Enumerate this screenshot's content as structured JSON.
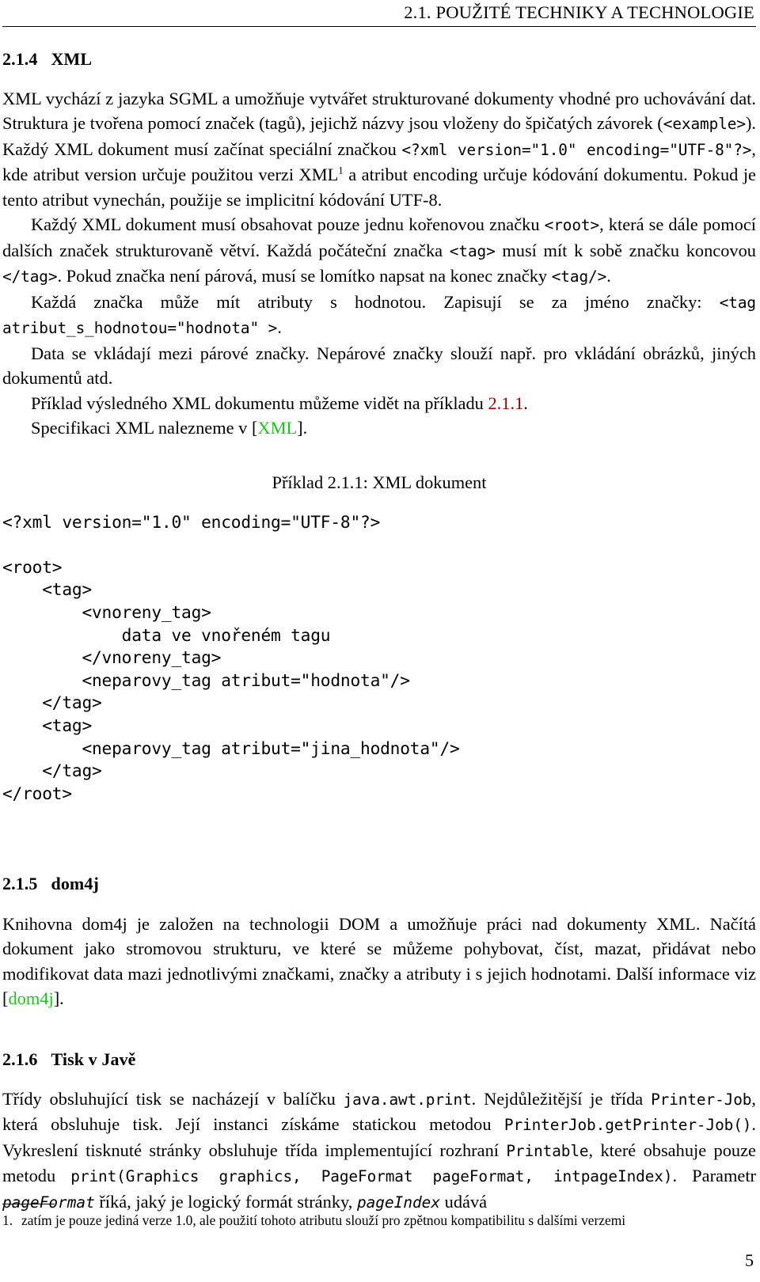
{
  "header": {
    "running_head": "2.1.  POUŽITÉ TECHNIKY A TECHNOLOGIE"
  },
  "sections": {
    "xml": {
      "number": "2.1.4",
      "title": "XML",
      "paragraphs": {
        "p1": {
          "t1": "XML vychází z jazyka SGML a umožňuje vytvářet strukturované dokumenty vhodné pro uchovávání dat. Struktura je tvořena pomocí značek (tagů), jejichž názvy jsou vloženy do špičatých závorek (",
          "c1": "<example>",
          "t2": "). Každý XML dokument musí začínat speciální značkou ",
          "c2": "<?xml version=\"1.0\" encoding=\"UTF-8\"?>",
          "t3": ", kde atribut version určuje použitou verzi XML",
          "fnmark": "1",
          "t4": " a atribut encoding určuje kódování dokumentu. Pokud je tento atribut vynechán, použije se implicitní kódování UTF-8."
        },
        "p2": {
          "t1": "Každý XML dokument musí obsahovat pouze jednu kořenovou značku ",
          "c1": "<root>",
          "t2": ", která se dále pomocí dalších značek strukturovaně větví. Každá počáteční značka ",
          "c2": "<tag>",
          "t3": " musí mít k sobě značku koncovou ",
          "c3": "</tag>",
          "t4": ". Pokud značka není párová, musí se lomítko napsat na konec značky ",
          "c4": "<tag/>",
          "t5": "."
        },
        "p3": {
          "t1": "Každá značka může mít atributy s hodnotou. Zapisují se za jméno značky: ",
          "c1": "<tag atribut_",
          "c2": "s_hodnotou=\"hodnota\" >",
          "t2": "."
        },
        "p4": {
          "t1": "Data se vkládají mezi párové značky. Nepárové značky slouží např. pro vkládání obrázků, jiných dokumentů atd."
        },
        "p5": {
          "t1": "Příklad výsledného XML dokumentu můžeme vidět na příkladu ",
          "ref": "2.1.1",
          "t2": "."
        },
        "p6": {
          "t1": "Specifikaci XML nalezneme v [",
          "cite": "XML",
          "t2": "]."
        }
      },
      "example": {
        "caption": "Příklad 2.1.1: XML dokument",
        "code": "<?xml version=\"1.0\" encoding=\"UTF-8\"?>\n\n<root>\n    <tag>\n        <vnoreny_tag>\n            data ve vnořeném tagu\n        </vnoreny_tag>\n        <neparovy_tag atribut=\"hodnota\"/>\n    </tag>\n    <tag>\n        <neparovy_tag atribut=\"jina_hodnota\"/>\n    </tag>\n</root>"
      }
    },
    "dom4j": {
      "number": "2.1.5",
      "title": "dom4j",
      "paragraph": {
        "t1": "Knihovna dom4j je založen na technologii DOM a umožňuje práci nad dokumenty XML. Načítá dokument jako stromovou strukturu, ve které se můžeme pohybovat, číst, mazat, přidávat nebo modifikovat data mazi jednotlivými značkami, značky a atributy i s jejich hodnotami. Další informace viz [",
        "cite": "dom4j",
        "t2": "]."
      }
    },
    "tisk": {
      "number": "2.1.6",
      "title": "Tisk v Javě",
      "paragraph": {
        "t1": "Třídy obsluhující tisk se nacházejí v balíčku ",
        "c1": "java.awt.print",
        "t2": ". Nejdůležitější je třída ",
        "c2": "Printer-",
        "c3": "Job",
        "t3": ", která obsluhuje tisk. Její instanci získáme statickou metodou ",
        "c4": "PrinterJob.getPrinter-",
        "c5": "Job()",
        "t4": ". Vykreslení tisknuté stránky obsluhuje třída implementující rozhraní ",
        "c6": "Printable",
        "t5": ", které obsahuje pouze metodu ",
        "c7": "print(Graphics graphics, PageFormat pageFormat, int",
        "c8": "pageIndex)",
        "t6": ". Parametr ",
        "i1": "pageFormat",
        "t7": " říká, jaký je logický formát stránky, ",
        "i2": "pageIndex",
        "t8": " udává"
      }
    }
  },
  "footnote": {
    "number": "1.",
    "text": "zatím je pouze jediná verze 1.0, ale použití tohoto atributu slouží pro zpětnou kompatibilitu s dalšími verzemi"
  },
  "page_number": "5",
  "colors": {
    "ref_link": "#a00000",
    "cite_link": "#18c818",
    "text": "#000000"
  }
}
